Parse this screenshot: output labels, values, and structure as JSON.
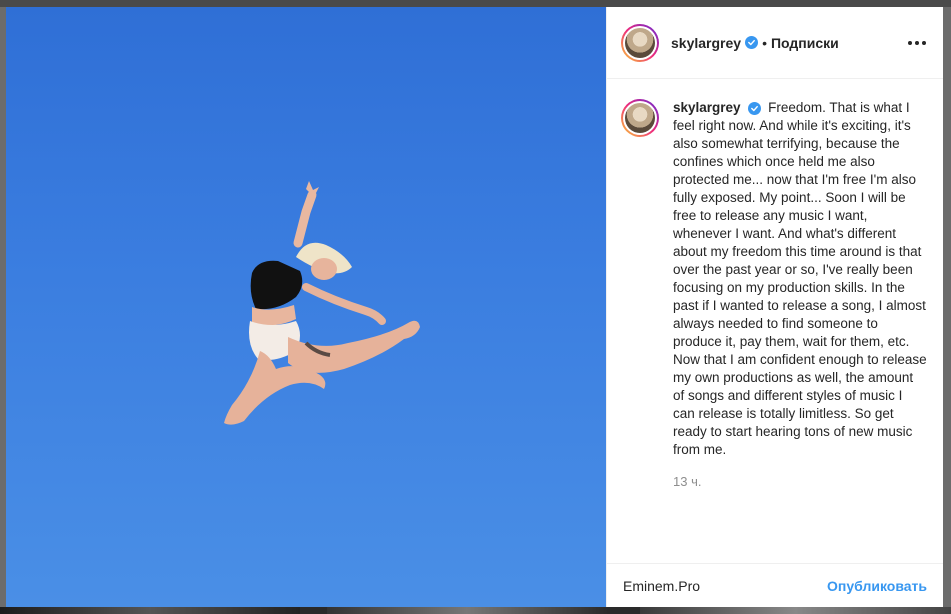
{
  "post": {
    "username": "skylargrey",
    "separator": "•",
    "follow_label": "Подписки",
    "caption": "Freedom. That is what I feel right now. And while it's exciting, it's also somewhat terrifying, because the confines which once held me also protected me... now that I'm free I'm also fully exposed. My point... Soon I will be free to release any music I want, whenever I want. And what's different about my freedom this time around is that over the past year or so, I've really been focusing on my production skills. In the past if I wanted to release a song, I almost always needed to find someone to produce it, pay them, wait for them, etc. Now that I am confident enough to release my own productions as well, the amount of songs and different styles of music I can release is totally limitless. So get ready to start hearing tons of new music from me.",
    "time": "13 ч."
  },
  "footer": {
    "comment_value": "Eminem.Pro",
    "publish_label": "Опубликовать"
  },
  "colors": {
    "sky": "#3b7ee0",
    "link": "#3897f0",
    "verified": "#3897f0"
  },
  "icons": {
    "verified": "verified-badge-icon",
    "more": "more-options-icon"
  }
}
